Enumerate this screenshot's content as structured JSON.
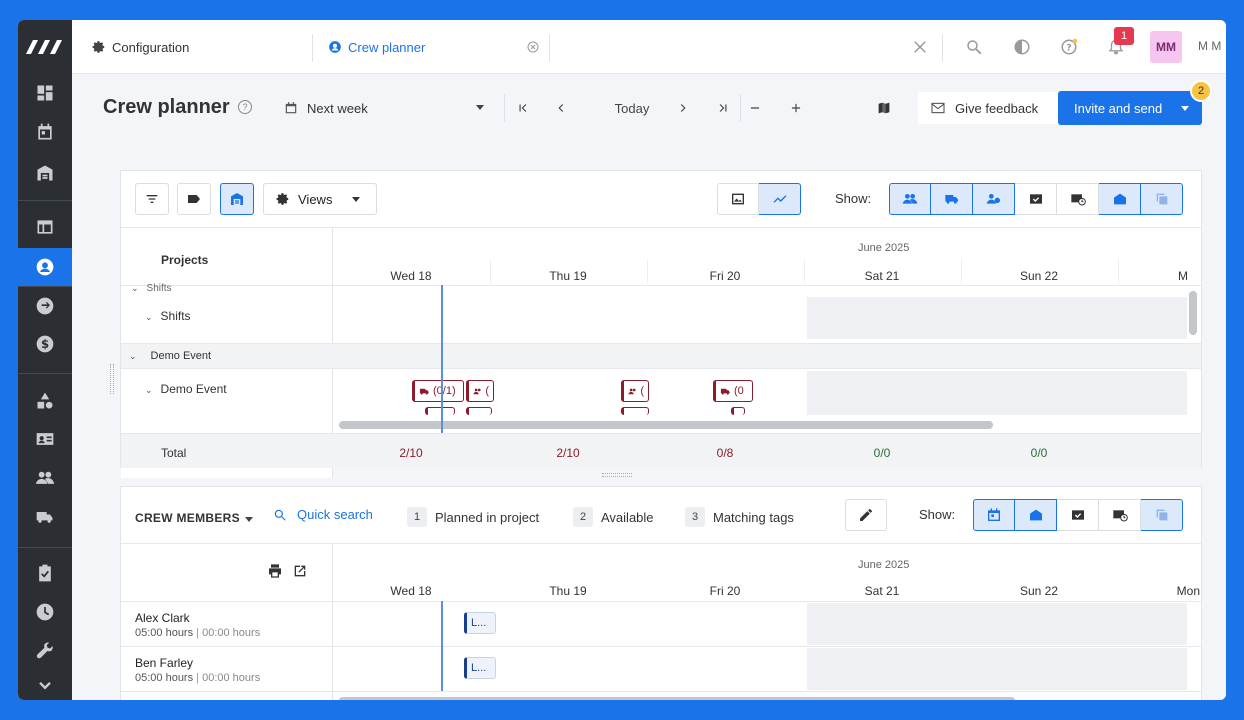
{
  "tabs": {
    "configuration": "Configuration",
    "crew_planner": "Crew planner"
  },
  "notifications": {
    "count": "1"
  },
  "user": {
    "initials": "MM",
    "name": "M M"
  },
  "page": {
    "title": "Crew planner",
    "range_label": "Next week",
    "today_label": "Today",
    "feedback_label": "Give feedback",
    "invite_label": "Invite and send",
    "invite_badge": "2"
  },
  "planner": {
    "views_label": "Views",
    "show_label": "Show:",
    "projects_header": "Projects",
    "month": "June 2025",
    "days": [
      "Wed 18",
      "Thu 19",
      "Fri 20",
      "Sat 21",
      "Sun 22",
      "M"
    ],
    "rows": {
      "shifts_group_cut": "Shifts",
      "shifts": "Shifts",
      "demo_event_group": "Demo Event",
      "demo_event": "Demo Event"
    },
    "chips": [
      "(0/1)",
      "(",
      "(",
      "(0"
    ],
    "total_label": "Total",
    "totals": [
      "2/10",
      "2/10",
      "0/8",
      "0/0",
      "0/0"
    ],
    "total_colors": [
      "#8a1c2c",
      "#8a1c2c",
      "#8a1c2c",
      "#2e6b3a",
      "#2e6b3a"
    ]
  },
  "crew": {
    "header": "CREW MEMBERS",
    "quick_search": "Quick search",
    "filters": [
      {
        "n": "1",
        "label": "Planned in project"
      },
      {
        "n": "2",
        "label": "Available"
      },
      {
        "n": "3",
        "label": "Matching tags"
      }
    ],
    "show_label": "Show:",
    "month": "June 2025",
    "days": [
      "Wed 18",
      "Thu 19",
      "Fri 20",
      "Sat 21",
      "Sun 22",
      "Mon"
    ],
    "members": [
      {
        "name": "Alex Clark",
        "planned": "05:00 hours",
        "sep": "|",
        "available": "00:00 hours",
        "chip": "L..."
      },
      {
        "name": "Ben Farley",
        "planned": "05:00 hours",
        "sep": "|",
        "available": "00:00 hours",
        "chip": "L..."
      }
    ]
  }
}
